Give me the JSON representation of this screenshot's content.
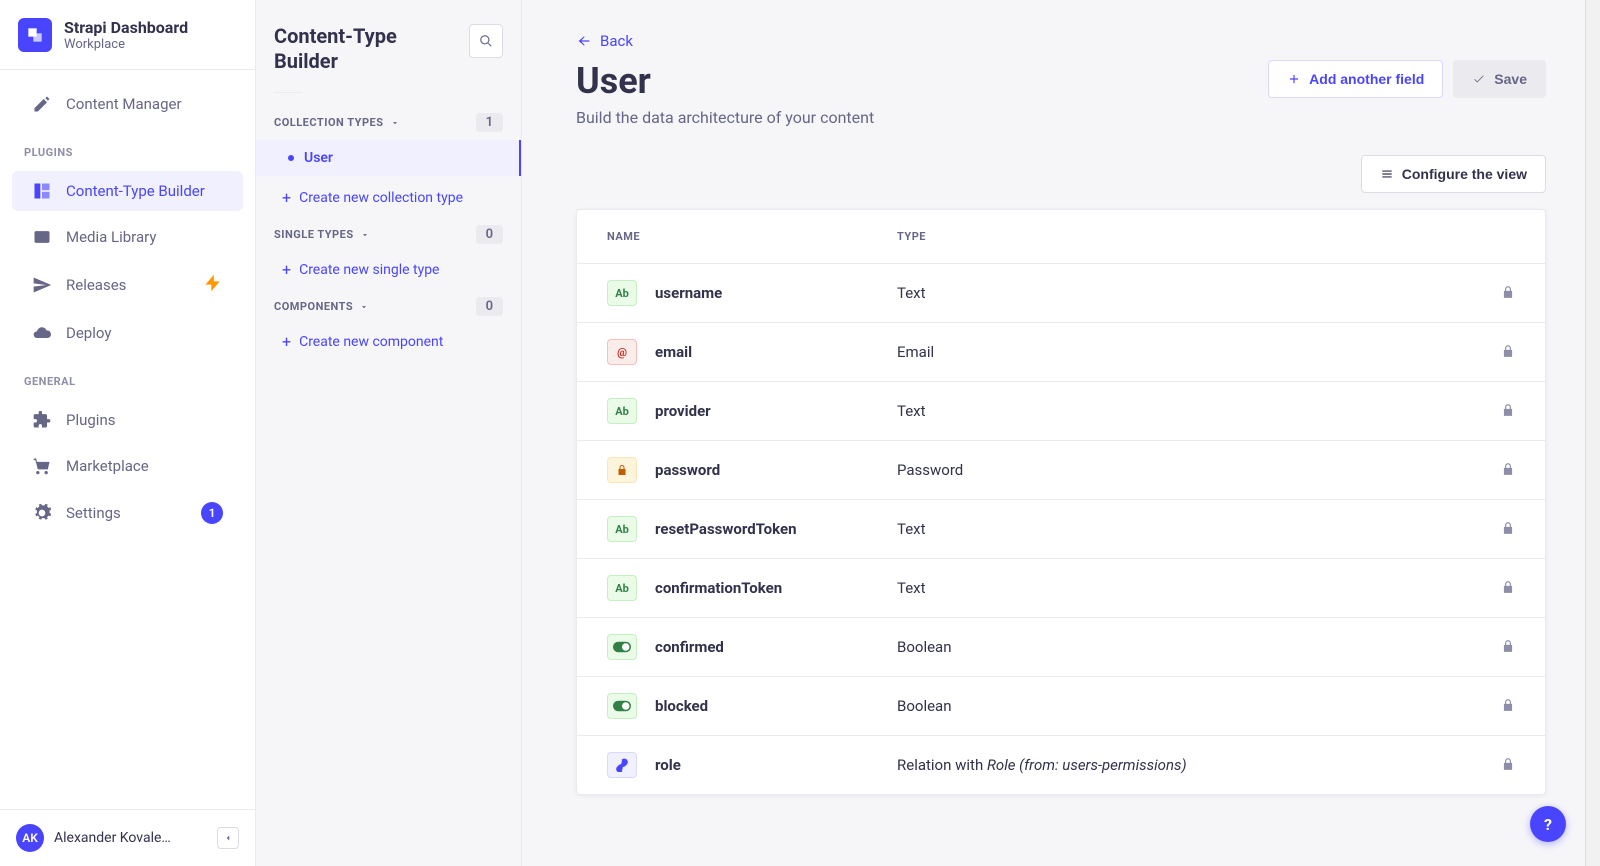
{
  "brand": {
    "title": "Strapi Dashboard",
    "subtitle": "Workplace"
  },
  "main_nav": {
    "content_manager": "Content Manager",
    "plugins_label": "PLUGINS",
    "ctb": "Content-Type Builder",
    "media": "Media Library",
    "releases": "Releases",
    "deploy": "Deploy",
    "general_label": "GENERAL",
    "plugins": "Plugins",
    "marketplace": "Marketplace",
    "settings": "Settings",
    "settings_badge": "1"
  },
  "user": {
    "initials": "AK",
    "name": "Alexander Kovale…"
  },
  "sub_sidebar": {
    "title": "Content-Type Builder",
    "collection_label": "COLLECTION TYPES",
    "collection_count": "1",
    "collection_items": [
      "User"
    ],
    "create_collection": "Create new collection type",
    "single_label": "SINGLE TYPES",
    "single_count": "0",
    "create_single": "Create new single type",
    "components_label": "COMPONENTS",
    "components_count": "0",
    "create_component": "Create new component"
  },
  "page": {
    "back": "Back",
    "title": "User",
    "subtitle": "Build the data architecture of your content",
    "add_field": "Add another field",
    "save": "Save",
    "configure": "Configure the view",
    "th_name": "NAME",
    "th_type": "TYPE"
  },
  "fields": [
    {
      "icon": "text",
      "icon_text": "Ab",
      "name": "username",
      "type_plain": "Text"
    },
    {
      "icon": "email",
      "icon_text": "@",
      "name": "email",
      "type_plain": "Email"
    },
    {
      "icon": "text",
      "icon_text": "Ab",
      "name": "provider",
      "type_plain": "Text"
    },
    {
      "icon": "pass",
      "icon_text": "lock",
      "name": "password",
      "type_plain": "Password"
    },
    {
      "icon": "text",
      "icon_text": "Ab",
      "name": "resetPasswordToken",
      "type_plain": "Text"
    },
    {
      "icon": "text",
      "icon_text": "Ab",
      "name": "confirmationToken",
      "type_plain": "Text"
    },
    {
      "icon": "bool",
      "icon_text": "toggle",
      "name": "confirmed",
      "type_plain": "Boolean"
    },
    {
      "icon": "bool",
      "icon_text": "toggle",
      "name": "blocked",
      "type_plain": "Boolean"
    },
    {
      "icon": "rel",
      "icon_text": "link",
      "name": "role",
      "type_prefix": "Relation with ",
      "type_em": "Role (from: users-permissions)"
    }
  ]
}
